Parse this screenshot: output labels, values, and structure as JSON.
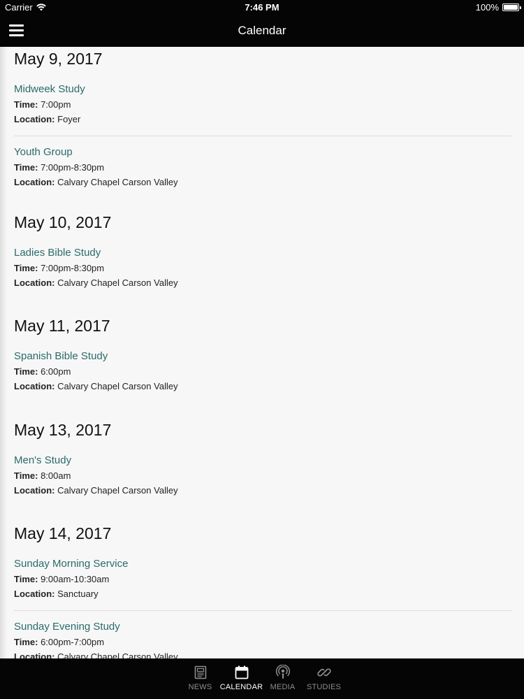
{
  "status": {
    "carrier": "Carrier",
    "time": "7:46 PM",
    "battery": "100%"
  },
  "nav": {
    "title": "Calendar",
    "menu_icon": "hamburger-menu-icon"
  },
  "days": [
    {
      "date": "May 9, 2017",
      "events": [
        {
          "title": "Midweek Study",
          "time_label": "Time:",
          "time": "7:00pm",
          "location_label": "Location:",
          "location": "Foyer"
        },
        {
          "title": "Youth Group",
          "time_label": "Time:",
          "time": "7:00pm-8:30pm",
          "location_label": "Location:",
          "location": "Calvary Chapel Carson Valley"
        }
      ]
    },
    {
      "date": "May 10, 2017",
      "events": [
        {
          "title": "Ladies Bible Study",
          "time_label": "Time:",
          "time": "7:00pm-8:30pm",
          "location_label": "Location:",
          "location": "Calvary Chapel Carson Valley"
        }
      ]
    },
    {
      "date": "May 11, 2017",
      "events": [
        {
          "title": "Spanish Bible Study",
          "time_label": "Time:",
          "time": "6:00pm",
          "location_label": "Location:",
          "location": "Calvary Chapel Carson Valley"
        }
      ]
    },
    {
      "date": "May 13, 2017",
      "events": [
        {
          "title": "Men's Study",
          "time_label": "Time:",
          "time": "8:00am",
          "location_label": "Location:",
          "location": "Calvary Chapel Carson Valley"
        }
      ]
    },
    {
      "date": "May 14, 2017",
      "events": [
        {
          "title": "Sunday Morning Service",
          "time_label": "Time:",
          "time": "9:00am-10:30am",
          "location_label": "Location:",
          "location": "Sanctuary"
        },
        {
          "title": "Sunday Evening Study",
          "time_label": "Time:",
          "time": "6:00pm-7:00pm",
          "location_label": "Location:",
          "location": "Calvary Chapel Carson Valley"
        }
      ]
    }
  ],
  "tabs": [
    {
      "label": "NEWS",
      "icon": "news-icon",
      "active": false
    },
    {
      "label": "CALENDAR",
      "icon": "calendar-icon",
      "active": true
    },
    {
      "label": "MEDIA",
      "icon": "podcast-icon",
      "active": false
    },
    {
      "label": "STUDIES",
      "icon": "link-icon",
      "active": false
    }
  ],
  "colors": {
    "bar_background": "#050505",
    "event_title": "#2c6a6a",
    "content_background": "#f7f7f7",
    "tab_inactive": "#8e8e8e",
    "tab_active": "#ffffff"
  }
}
